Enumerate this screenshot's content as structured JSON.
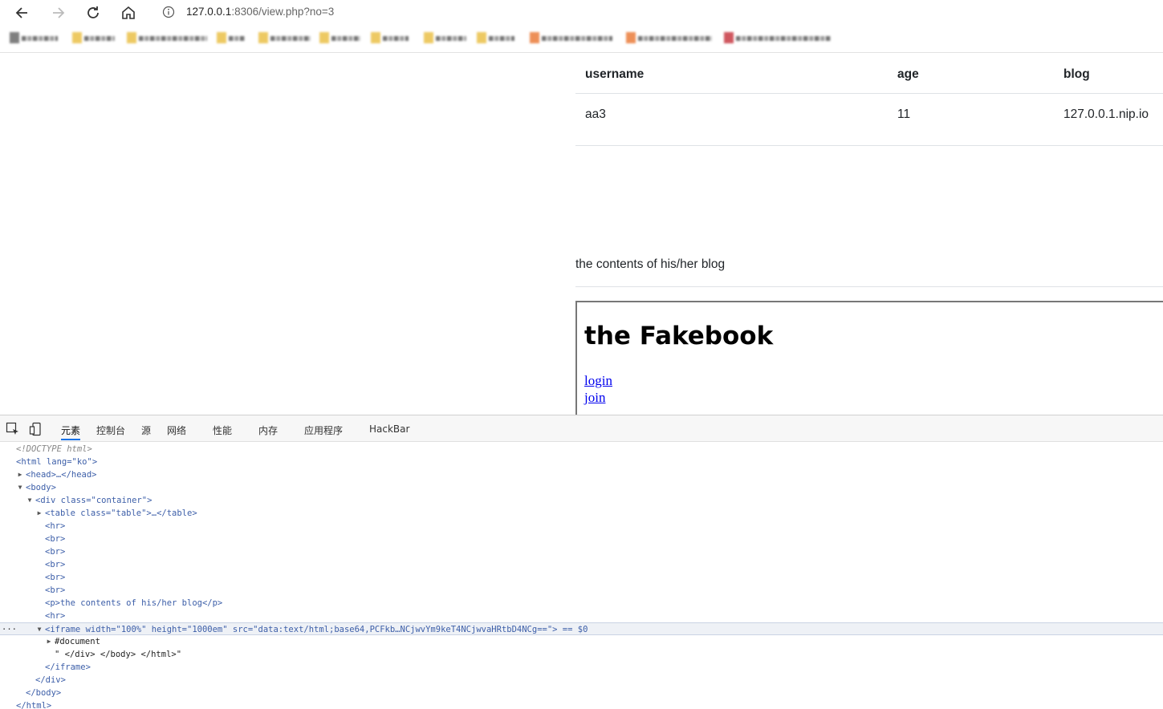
{
  "browser": {
    "url_host": "127.0.0.1",
    "url_rest": ":8306/view.php?no=3"
  },
  "table": {
    "headers": [
      "username",
      "age",
      "blog"
    ],
    "row": [
      "aa3",
      "11",
      "127.0.0.1.nip.io"
    ]
  },
  "page": {
    "contents_text": "the contents of his/her blog",
    "iframe_title": "the Fakebook",
    "links": [
      "login",
      "join"
    ]
  },
  "devtools": {
    "tabs": [
      "元素",
      "控制台",
      "源",
      "网络",
      "性能",
      "内存",
      "应用程序",
      "HackBar"
    ],
    "active_tab": "元素",
    "lines": [
      "<!DOCTYPE html>",
      "<html lang=\"ko\">",
      "<head>…</head>",
      "<body>",
      "<div class=\"container\">",
      "<table class=\"table\">…</table>",
      "<hr>",
      "<br>",
      "<br>",
      "<br>",
      "<br>",
      "<br>",
      "<p>the contents of his/her blog</p>",
      "<hr>",
      "<iframe width=\"100%\" height=\"1000em\" src=\"data:text/html;base64,PCFkb…NCjwvYm9keT4NCjwvaHRtbD4NCg==\"> == $0",
      "#document",
      "\" </div> </body> </html>\"",
      "</iframe>",
      "</div>",
      "</body>",
      "</html>"
    ],
    "selected_marker": "== $0",
    "iframe_src": "data:text/html;base64,PCFkb…NCjwvYm9keT4NCjwvaHRtbD4NCg=="
  }
}
